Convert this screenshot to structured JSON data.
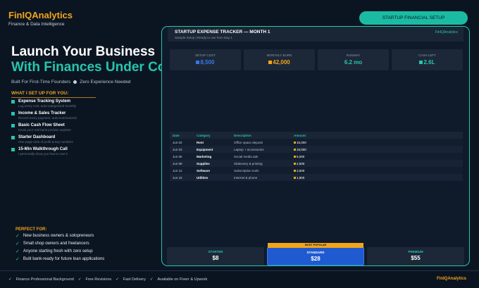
{
  "brand": {
    "name": "FinIQAnalytics",
    "tagline": "Finance & Data Intelligence"
  },
  "cta": {
    "label": "STARTUP FINANCIAL SETUP"
  },
  "hero": {
    "line1": "Launch Your Business",
    "line2": "With Finances Under Cor",
    "sub_a": "Built For First-Time Founders",
    "sub_b": "Zero Experience Needed"
  },
  "setup": {
    "title": "WHAT I SET UP FOR YOU:",
    "items": [
      {
        "title": "Expense Tracking System",
        "desc": "Log every cost, auto-categorized monthly"
      },
      {
        "title": "Income & Sales Tracker",
        "desc": "Record every payment, auto-summarized"
      },
      {
        "title": "Basic Cash Flow Sheet",
        "desc": "Know your real bank position anytime"
      },
      {
        "title": "Starter Dashboard",
        "desc": "One-page view of profit & key numbers"
      },
      {
        "title": "15-Min Walkthrough Call",
        "desc": "I personally show you how to use it"
      }
    ]
  },
  "perfect": {
    "title": "PERFECT FOR:",
    "items": [
      "New business owners & solopreneurs",
      "Small shop owners and freelancers",
      "Anyone starting fresh with zero setup",
      "Built bank-ready for future loan applications"
    ]
  },
  "footer": {
    "items": [
      "Finance Professional Background",
      "Free Revisions",
      "Fast Delivery",
      "Available on Fiverr & Upwork"
    ],
    "brand": "FinIQAnalytics"
  },
  "panel": {
    "title": "STARTUP EXPENSE TRACKER — MONTH 1",
    "subtitle": "Sample Setup  |  Ready to use from Day 1",
    "brand": "FinIQAnalytics",
    "kpis": [
      {
        "label": "SETUP COST",
        "value": "8,500",
        "color": "#3a78e8"
      },
      {
        "label": "MONTHLY BURN",
        "value": "42,000",
        "color": "#f2a51a"
      },
      {
        "label": "RUNWAY",
        "value": "6.2 mo",
        "color": "#27c5ac"
      },
      {
        "label": "CASH LEFT",
        "value": "2.6L",
        "color": "#27c5ac"
      }
    ],
    "table": {
      "headers": [
        "Date",
        "Category",
        "Description",
        "Amount"
      ],
      "rows": [
        {
          "date": "Jun 02",
          "category": "Rent",
          "description": "Office space deposit",
          "amount": "15,000"
        },
        {
          "date": "Jun 03",
          "category": "Equipment",
          "description": "Laptop + accessories",
          "amount": "18,000"
        },
        {
          "date": "Jun 05",
          "category": "Marketing",
          "description": "Social media ads",
          "amount": "5,000"
        },
        {
          "date": "Jun 08",
          "category": "Supplies",
          "description": "Stationery & printing",
          "amount": "2,500"
        },
        {
          "date": "Jun 12",
          "category": "Software",
          "description": "Subscription tools",
          "amount": "3,600"
        },
        {
          "date": "Jun 15",
          "category": "Utilities",
          "description": "Internet & phone",
          "amount": "1,800"
        }
      ]
    },
    "packages": [
      {
        "name": "STARTER",
        "price": "$8",
        "badge": ""
      },
      {
        "name": "STANDARD",
        "price": "$28",
        "badge": "MOST POPULAR"
      },
      {
        "name": "PREMIUM",
        "price": "$55",
        "badge": ""
      }
    ]
  }
}
